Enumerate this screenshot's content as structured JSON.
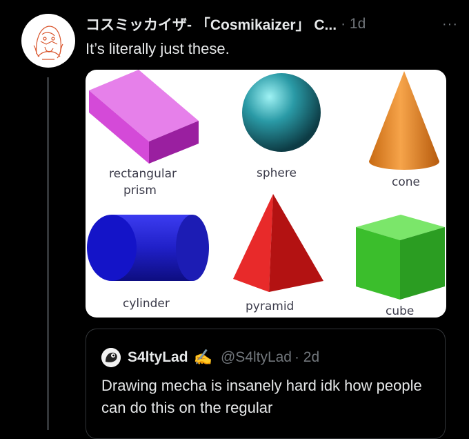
{
  "tweet": {
    "display_name": "コスミッカイザ- 「Cosmikaizer」 C...",
    "time": "· 1d",
    "more_icon": "more-horizontal-icon",
    "text": "It’s literally just these.",
    "avatar_icon": "sketch-avatar"
  },
  "media": {
    "labels": {
      "rect_line1": "rectangular",
      "rect_line2": "prism",
      "sphere": "sphere",
      "cone": "cone",
      "cylinder": "cylinder",
      "pyramid": "pyramid",
      "cube": "cube"
    }
  },
  "quote": {
    "display_name": "S4ltyLad",
    "emoji": "✍️",
    "handle": "@S4ltyLad",
    "time": "· 2d",
    "text": "Drawing mecha is insanely hard idk how people can do this on the regular"
  },
  "colors": {
    "background": "#000000",
    "text": "#e7e9ea",
    "secondary": "#71767b",
    "border": "#333639"
  }
}
